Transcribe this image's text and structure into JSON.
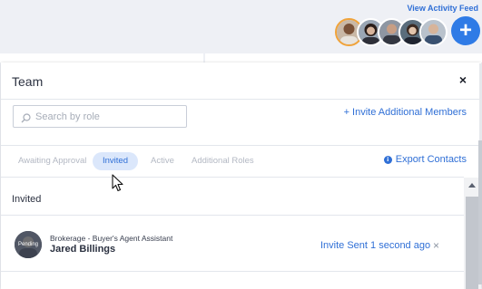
{
  "header": {
    "activity_link": "View Activity Feed",
    "add_button": "+"
  },
  "modal": {
    "title": "Team",
    "close": "×",
    "search_placeholder": "Search by role",
    "invite_link": "+ Invite Additional Members",
    "tabs": [
      {
        "label": "Awaiting Approval",
        "active": false
      },
      {
        "label": "Invited",
        "active": true
      },
      {
        "label": "Active",
        "active": false
      },
      {
        "label": "Additional Roles",
        "active": false
      }
    ],
    "export_link": "Export Contacts",
    "section_label": "Invited",
    "members": [
      {
        "avatar_badge": "Pending",
        "role": "Brokerage - Buyer's Agent Assistant",
        "name": "Jared Billings",
        "status": "Invite Sent 1 second ago",
        "remove": "×"
      }
    ]
  },
  "colors": {
    "accent": "#2f6fd6",
    "add_button": "#2f7be6",
    "active_tab_bg": "#dbe7fb"
  }
}
